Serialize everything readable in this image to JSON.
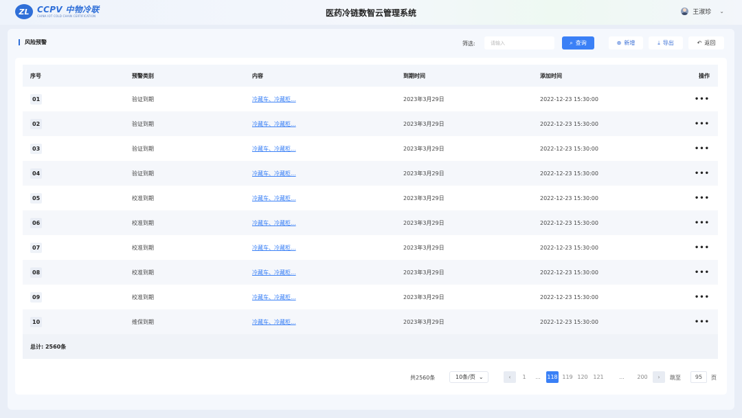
{
  "header": {
    "logo_mark": "ZL",
    "logo_name": "CCPV 中物冷联",
    "logo_sub": "CHINA IOT COLD CHAIN CERTIFICATION",
    "title": "医药冷链数智云管理系统",
    "user_name": "王淑珍"
  },
  "toolbar": {
    "section_title": "风险预警",
    "filter_label": "筛选:",
    "search_placeholder": "请输入",
    "query_label": "查询",
    "add_label": "新增",
    "export_label": "导出",
    "back_label": "返回"
  },
  "table": {
    "columns": [
      "序号",
      "预警类别",
      "内容",
      "到期时间",
      "添加时间",
      "操作"
    ],
    "rows": [
      {
        "no": "01",
        "category": "验证到期",
        "content": "冷藏车、冷藏柜...",
        "expire": "2023年3月29日",
        "added": "2022-12-23 15:30:00",
        "action": "•••"
      },
      {
        "no": "02",
        "category": "验证到期",
        "content": "冷藏车、冷藏柜...",
        "expire": "2023年3月29日",
        "added": "2022-12-23 15:30:00",
        "action": "•••"
      },
      {
        "no": "03",
        "category": "验证到期",
        "content": "冷藏车、冷藏柜...",
        "expire": "2023年3月29日",
        "added": "2022-12-23 15:30:00",
        "action": "•••"
      },
      {
        "no": "04",
        "category": "验证到期",
        "content": "冷藏车、冷藏柜...",
        "expire": "2023年3月29日",
        "added": "2022-12-23 15:30:00",
        "action": "•••"
      },
      {
        "no": "05",
        "category": "校准到期",
        "content": "冷藏车、冷藏柜...",
        "expire": "2023年3月29日",
        "added": "2022-12-23 15:30:00",
        "action": "•••"
      },
      {
        "no": "06",
        "category": "校准到期",
        "content": "冷藏车、冷藏柜...",
        "expire": "2023年3月29日",
        "added": "2022-12-23 15:30:00",
        "action": "•••"
      },
      {
        "no": "07",
        "category": "校准到期",
        "content": "冷藏车、冷藏柜...",
        "expire": "2023年3月29日",
        "added": "2022-12-23 15:30:00",
        "action": "•••"
      },
      {
        "no": "08",
        "category": "校准到期",
        "content": "冷藏车、冷藏柜...",
        "expire": "2023年3月29日",
        "added": "2022-12-23 15:30:00",
        "action": "•••"
      },
      {
        "no": "09",
        "category": "校准到期",
        "content": "冷藏车、冷藏柜...",
        "expire": "2023年3月29日",
        "added": "2022-12-23 15:30:00",
        "action": "•••"
      },
      {
        "no": "10",
        "category": "维保到期",
        "content": "冷藏车、冷藏柜...",
        "expire": "2023年3月29日",
        "added": "2022-12-23 15:30:00",
        "action": "•••"
      }
    ],
    "total_label": "总计: 2560条"
  },
  "pagination": {
    "total": "共2560条",
    "page_size": "10条/页",
    "prev": "‹",
    "pages": [
      "1",
      "...",
      "118",
      "119",
      "120",
      "121",
      "...",
      "200",
      "›"
    ],
    "current": "118",
    "jump_label": "跳至",
    "jump_value": "95",
    "jump_suffix": "页"
  },
  "colors": {
    "accent": "#3a80f6",
    "brand": "#2f6fd8"
  }
}
